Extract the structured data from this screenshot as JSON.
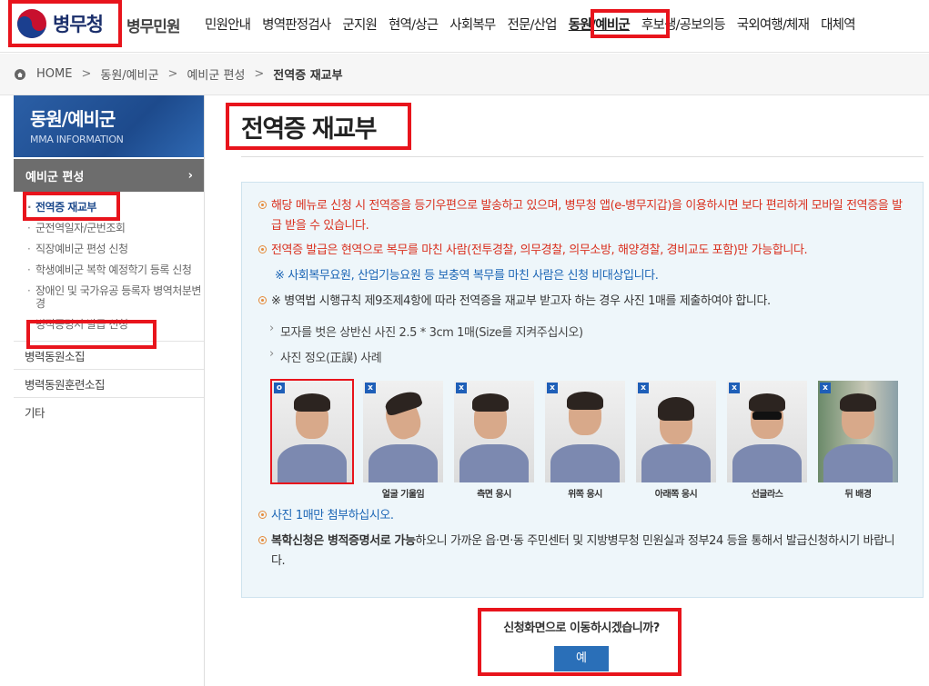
{
  "header": {
    "logo_text": "병무청",
    "site_name": "병무민원",
    "nav": [
      "민원안내",
      "병역판정검사",
      "군지원",
      "현역/상근",
      "사회복무",
      "전문/산업",
      "동원/예비군",
      "후보생/공보의등",
      "국외여행/체재",
      "대체역"
    ],
    "active_nav": "동원/예비군"
  },
  "breadcrumb": {
    "home": "HOME",
    "sep": ">",
    "level1": "동원/예비군",
    "level2": "예비군 편성",
    "current": "전역증 재교부"
  },
  "sidebar": {
    "title": "동원/예비군",
    "subtitle": "MMA INFORMATION",
    "category": "예비군 편성",
    "category_arrow": "›",
    "sub_items": [
      "전역증 재교부",
      "군전역일자/군번조회",
      "직장예비군 편성 신청",
      "학생예비군 복학 예정학기 등록 신청",
      "장애인 및 국가유공 등록자 병역처분변경",
      "병적증명서 발급 신청"
    ],
    "main_items": [
      "병력동원소집",
      "병력동원훈련소집",
      "기타"
    ]
  },
  "content": {
    "page_title": "전역증 재교부",
    "p1": "해당 메뉴로 신청 시 전역증을 등기우편으로 발송하고 있으며, 병무청 앱(e-병무지갑)을 이용하시면 보다 편리하게 모바일 전역증을 발급 받을 수 있습니다.",
    "p2": "전역증 발급은 현역으로 복무를 마친 사람(전투경찰, 의무경찰, 의무소방, 해양경찰, 경비교도 포함)만 가능합니다.",
    "p2_note": "※ 사회복무요원, 산업기능요원 등 보충역 복무를 마친 사람은 신청 비대상입니다.",
    "p3": "※ 병역법 시행규칙 제9조제4항에 따라 전역증을 재교부 받고자 하는 경우 사진 1매를 제출하여야 합니다.",
    "sub1": "모자를 벗은 상반신 사진 2.5 * 3cm 1매(Size를 지켜주십시오)",
    "sub2": "사진 정오(正誤) 사례",
    "photo_badges": [
      "o",
      "x",
      "x",
      "x",
      "x",
      "x",
      "x"
    ],
    "photo_captions": [
      "",
      "얼굴 기울임",
      "측면 응시",
      "위쪽 응시",
      "아래쪽 응시",
      "선글라스",
      "뒤 배경"
    ],
    "p4": "사진 1매만 첨부하십시오.",
    "p5_bold1": "복학신청은 ",
    "p5_bold2": "병적증명서로 가능",
    "p5_rest": "하오니 가까운 읍·면·동 주민센터 및 지방병무청 민원실과 정부24 등을 통해서 발급신청하시기 바랍니다."
  },
  "confirm": {
    "question": "신청화면으로 이동하시겠습니까?",
    "yes_label": "예"
  },
  "colors": {
    "highlight": "#e8141c",
    "brand_blue": "#1d4a8c",
    "notice_red": "#d9301f",
    "notice_blue": "#1b65b5",
    "button": "#2a6fb8"
  }
}
